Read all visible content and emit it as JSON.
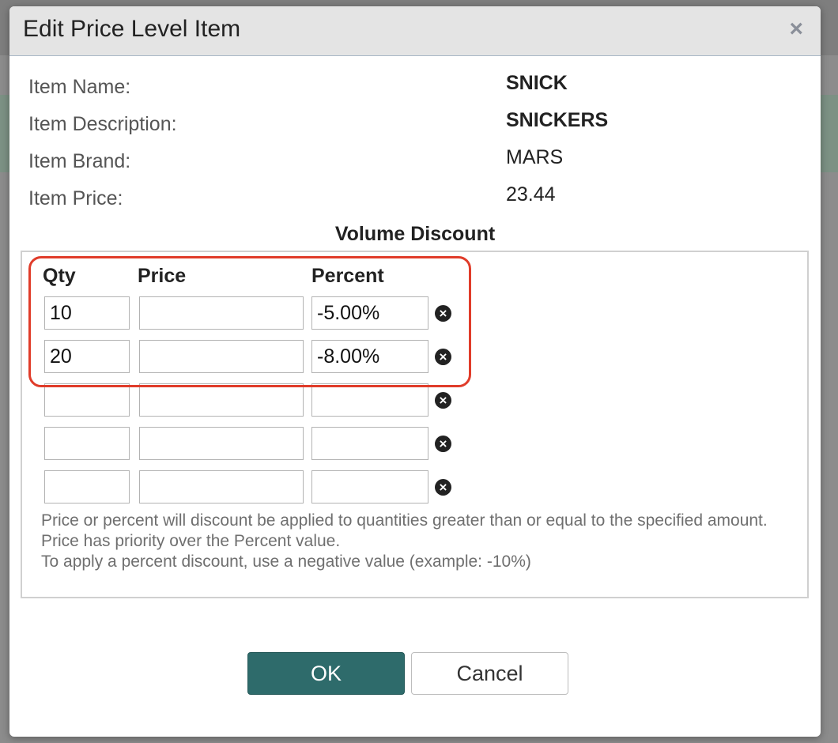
{
  "dialog": {
    "title": "Edit Price Level Item",
    "close_glyph": "×"
  },
  "item_info": {
    "name_label": "Item Name:",
    "name_value": "SNICK",
    "description_label": "Item Description:",
    "description_value": "SNICKERS",
    "brand_label": "Item Brand:",
    "brand_value": "MARS",
    "price_label": "Item Price:",
    "price_value": "23.44"
  },
  "volume_discount": {
    "title": "Volume Discount",
    "columns": {
      "qty": "Qty",
      "price": "Price",
      "percent": "Percent"
    },
    "rows": [
      {
        "qty": "10",
        "price": "",
        "percent": "-5.00%"
      },
      {
        "qty": "20",
        "price": "",
        "percent": "-8.00%"
      },
      {
        "qty": "",
        "price": "",
        "percent": ""
      },
      {
        "qty": "",
        "price": "",
        "percent": ""
      },
      {
        "qty": "",
        "price": "",
        "percent": ""
      }
    ],
    "remove_glyph": "×",
    "notes": [
      "Price or percent will discount be applied to quantities greater than or equal to the specified amount.",
      "Price has priority over the Percent value.",
      "To apply a percent discount, use a negative value (example: -10%)"
    ]
  },
  "buttons": {
    "ok": "OK",
    "cancel": "Cancel"
  },
  "colors": {
    "ok_button": "#2e6b6b",
    "highlight_outline": "#e03c2a"
  }
}
